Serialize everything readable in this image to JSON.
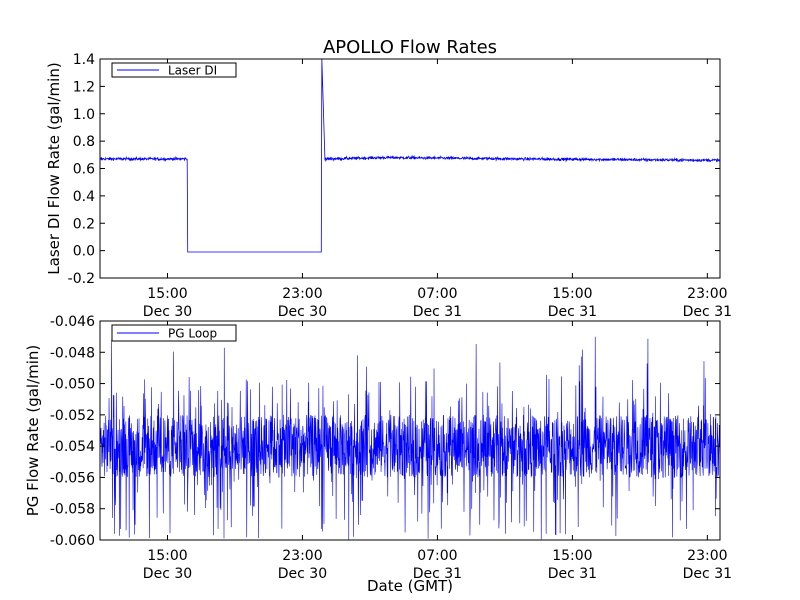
{
  "figure": {
    "title": "APOLLO Flow Rates",
    "xlabel": "Date (GMT)"
  },
  "chart_data": [
    {
      "type": "line",
      "title": "APOLLO Flow Rates",
      "ylabel": "Laser DI Flow Rate (gal/min)",
      "xlabel": "",
      "xlim": [
        "2013-12-30 11:00",
        "2013-12-31 23:45"
      ],
      "ylim": [
        -0.2,
        1.4
      ],
      "yticks": [
        "-0.2",
        "0.0",
        "0.2",
        "0.4",
        "0.6",
        "0.8",
        "1.0",
        "1.2",
        "1.4"
      ],
      "xticks": [
        {
          "time": "15:00",
          "date": "Dec 30"
        },
        {
          "time": "23:00",
          "date": "Dec 30"
        },
        {
          "time": "07:00",
          "date": "Dec 31"
        },
        {
          "time": "15:00",
          "date": "Dec 31"
        },
        {
          "time": "23:00",
          "date": "Dec 31"
        }
      ],
      "legend": {
        "position": "top-left"
      },
      "grid": false,
      "color": "#0000ff",
      "series": [
        {
          "name": "Laser DI",
          "x": [
            "2013-12-30 11:00",
            "2013-12-30 16:10",
            "2013-12-30 16:12",
            "2013-12-31 00:07",
            "2013-12-31 00:09",
            "2013-12-31 00:20",
            "2013-12-31 04:00",
            "2013-12-31 12:00",
            "2013-12-31 18:00",
            "2013-12-31 23:45"
          ],
          "y": [
            0.67,
            0.67,
            -0.01,
            -0.01,
            1.4,
            0.67,
            0.68,
            0.67,
            0.665,
            0.66
          ]
        }
      ]
    },
    {
      "type": "line",
      "title": "",
      "ylabel": "PG Flow Rate (gal/min)",
      "xlabel": "Date (GMT)",
      "xlim": [
        "2013-12-30 11:00",
        "2013-12-31 23:45"
      ],
      "ylim": [
        -0.06,
        -0.046
      ],
      "yticks": [
        "-0.060",
        "-0.058",
        "-0.056",
        "-0.054",
        "-0.052",
        "-0.050",
        "-0.048",
        "-0.046"
      ],
      "xticks": [
        {
          "time": "15:00",
          "date": "Dec 30"
        },
        {
          "time": "23:00",
          "date": "Dec 30"
        },
        {
          "time": "07:00",
          "date": "Dec 31"
        },
        {
          "time": "15:00",
          "date": "Dec 31"
        },
        {
          "time": "23:00",
          "date": "Dec 31"
        }
      ],
      "legend": {
        "position": "top-left"
      },
      "grid": false,
      "color": "#0000ff",
      "series": [
        {
          "name": "PG Loop",
          "x": [
            "2013-12-30 11:00",
            "2013-12-31 23:45"
          ],
          "y": [
            -0.054,
            -0.054
          ],
          "typical_range": [
            -0.056,
            -0.052
          ],
          "extreme_range": [
            -0.06,
            -0.047
          ]
        }
      ]
    }
  ]
}
